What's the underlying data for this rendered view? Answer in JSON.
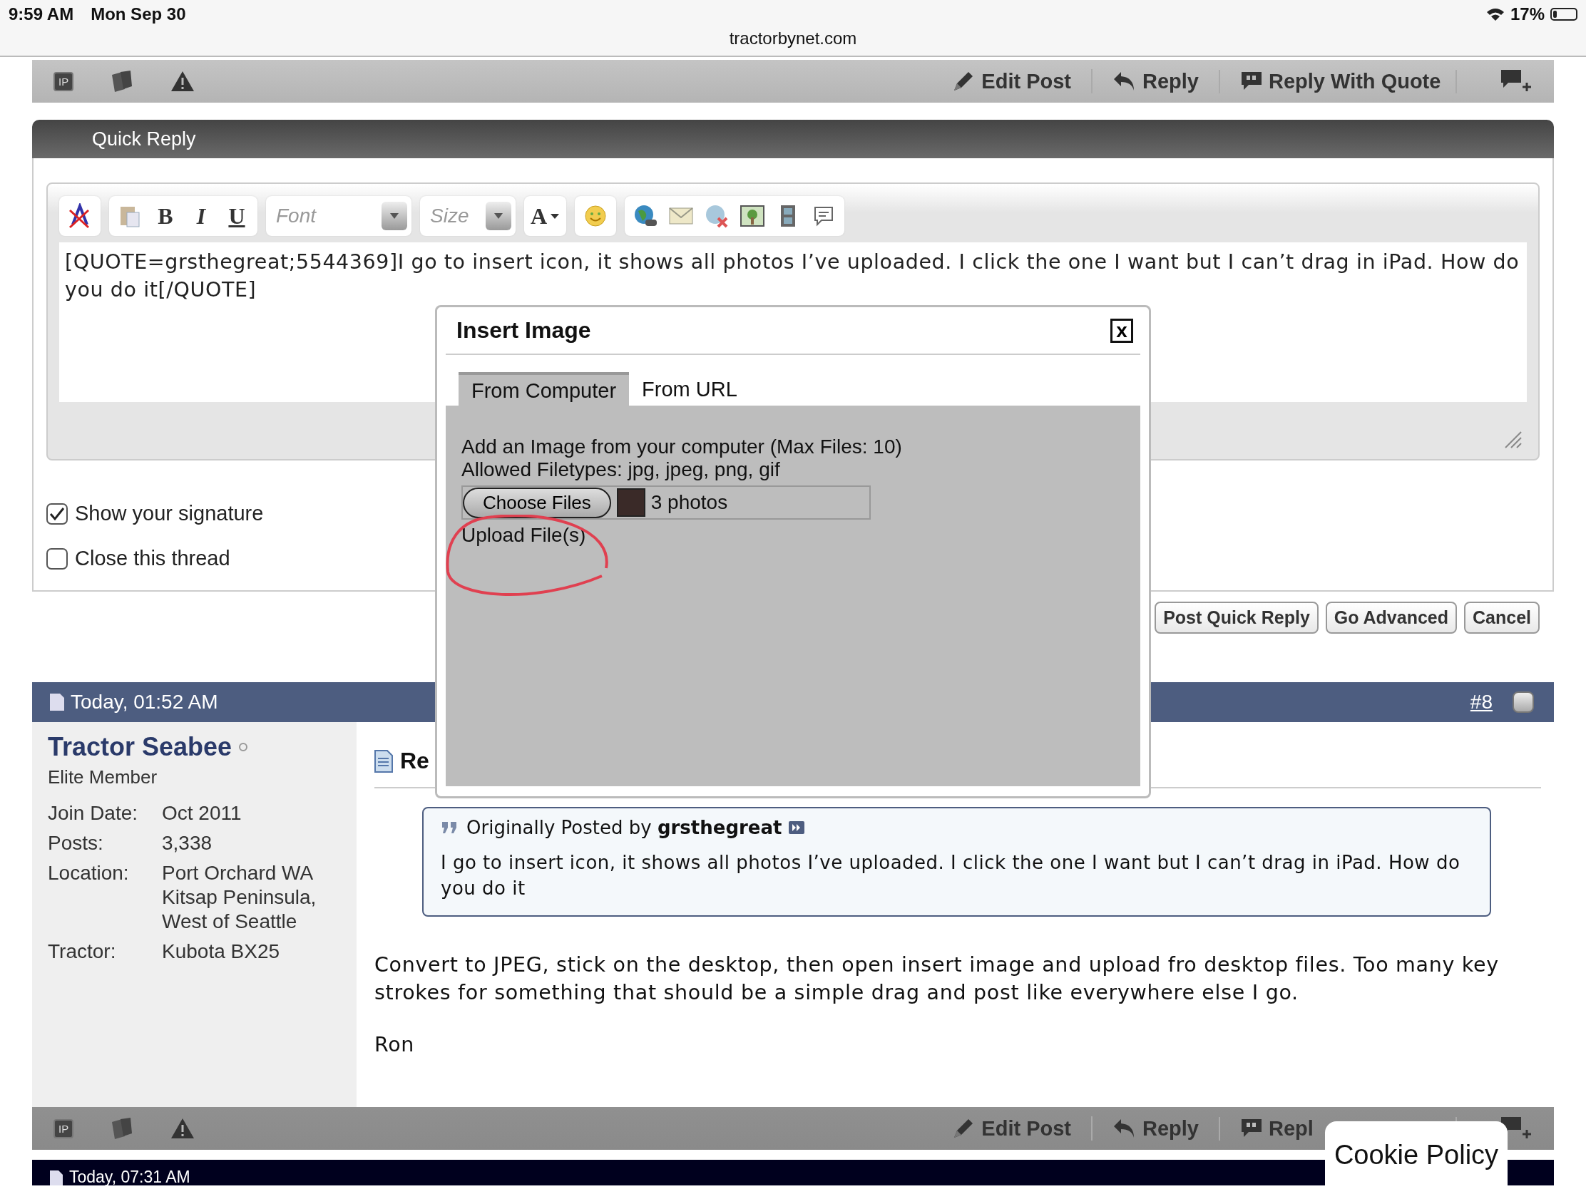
{
  "status_bar": {
    "time": "9:59 AM",
    "date": "Mon Sep 30",
    "battery": "17%"
  },
  "address_bar": {
    "url": "tractorbynet.com"
  },
  "post_bar_top": {
    "icons": [
      {
        "kind": "ip",
        "label": "IP"
      },
      {
        "kind": "cards"
      },
      {
        "kind": "warning"
      }
    ],
    "actions": [
      {
        "kind": "edit",
        "label": "Edit Post"
      },
      {
        "kind": "reply",
        "label": "Reply"
      },
      {
        "kind": "quote",
        "label": "Reply With Quote"
      },
      {
        "kind": "multiquote"
      }
    ]
  },
  "quick_reply": {
    "title": "Quick Reply",
    "toolbar": [
      [
        {
          "kind": "clear-format"
        }
      ],
      [
        {
          "kind": "paste"
        },
        {
          "kind": "bold",
          "label": "B"
        },
        {
          "kind": "italic",
          "label": "I"
        },
        {
          "kind": "underline",
          "label": "U"
        }
      ],
      [
        {
          "kind": "font",
          "placeholder": "Font"
        }
      ],
      [
        {
          "kind": "size",
          "placeholder": "Size"
        }
      ],
      [
        {
          "kind": "color",
          "label": "A"
        }
      ],
      [
        {
          "kind": "smiley"
        }
      ],
      [
        {
          "kind": "link"
        },
        {
          "kind": "email"
        },
        {
          "kind": "unlink"
        },
        {
          "kind": "image"
        },
        {
          "kind": "video"
        },
        {
          "kind": "quote"
        }
      ]
    ],
    "text": "[QUOTE=grsthegreat;5544369]I go to insert icon, it shows all photos I’ve uploaded. I click the one I want but I can’t drag in iPad. How do you do it[/QUOTE]",
    "options": [
      {
        "label": "Show your signature",
        "checked": true
      },
      {
        "label": "Close this thread",
        "checked": false
      }
    ],
    "buttons": [
      "Post Quick Reply",
      "Go Advanced",
      "Cancel"
    ]
  },
  "post": {
    "date": "Today, 01:52 AM",
    "number": "#8",
    "multi_select_checked": false,
    "author": "Tractor Seabee",
    "online": false,
    "rank": "Elite Member",
    "details": [
      {
        "label": "Join Date:",
        "value": "Oct 2011"
      },
      {
        "label": "Posts:",
        "value": "3,338"
      },
      {
        "label": "Location:",
        "value": "Port Orchard WA Kitsap Peninsula, West of Seattle"
      },
      {
        "label": "Tractor:",
        "value": "Kubota BX25"
      }
    ],
    "title": "Re",
    "quote": {
      "prefix": "Originally Posted by",
      "author": "grsthegreat",
      "text": "I go to insert icon, it shows all photos I’ve uploaded. I click the one I want but I can’t drag in iPad. How do you do it"
    },
    "body": [
      "Convert to JPEG, stick on the desktop, then open insert image and upload fro desktop files. Too many key strokes for something that should be a simple drag and post like everywhere else I go.",
      "Ron"
    ]
  },
  "post_bar_bottom": {
    "icons": [
      {
        "kind": "ip",
        "label": "IP"
      },
      {
        "kind": "cards"
      },
      {
        "kind": "warning"
      }
    ],
    "actions": [
      {
        "kind": "edit",
        "label": "Edit Post"
      },
      {
        "kind": "reply",
        "label": "Reply"
      },
      {
        "kind": "quote",
        "label": "Repl"
      },
      {
        "kind": "multiquote"
      }
    ]
  },
  "next_post": {
    "date": "Today, 07:31 AM"
  },
  "cookie_banner": {
    "label": "Cookie Policy"
  },
  "dialog": {
    "title": "Insert Image",
    "close": "x",
    "tabs": [
      {
        "label": "From Computer",
        "selected": true
      },
      {
        "label": "From URL",
        "selected": false
      }
    ],
    "lines": [
      "Add an Image from your computer (Max Files: 10)",
      "Allowed Filetypes: jpg, jpeg, png, gif"
    ],
    "file_button": "Choose Files",
    "file_value": "3 photos",
    "upload": "Upload File(s)"
  }
}
